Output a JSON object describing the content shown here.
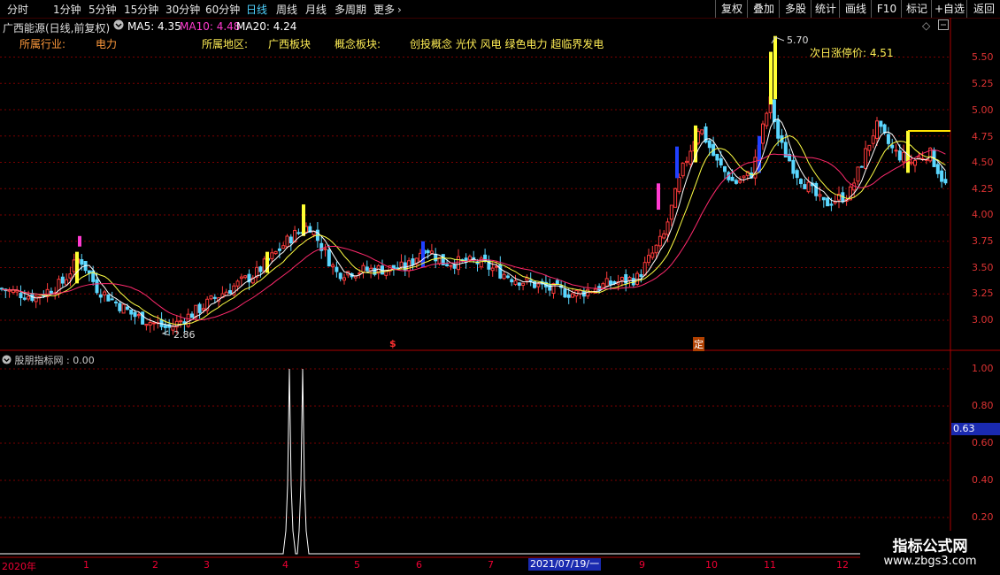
{
  "toolbar": {
    "timeframes": [
      "分时",
      "1分钟",
      "5分钟",
      "15分钟",
      "30分钟",
      "60分钟",
      "日线",
      "周线",
      "月线",
      "多周期",
      "更多"
    ],
    "buttons": [
      "复权",
      "叠加",
      "多股",
      "统计",
      "画线",
      "F10",
      "标记",
      "+自选",
      "返回"
    ]
  },
  "header": {
    "title": "广西能源(日线,前复权)",
    "ma5": "MA5: 4.35",
    "ma10": "MA10: 4.48",
    "ma20": "MA20: 4.24"
  },
  "categories": {
    "industry_label": "所属行业:",
    "industry_value": "电力",
    "region_label": "所属地区:",
    "region_value": "广西板块",
    "concept_label": "概念板块:",
    "concept_value": "创投概念 光伏 风电 绿色电力 超临界发电"
  },
  "annotations": {
    "high": "5.70",
    "low": "2.86",
    "limit_up": "次日涨停价: 4.51",
    "marker1": "$",
    "marker2": "定"
  },
  "price_axis": [
    "5.50",
    "5.25",
    "5.00",
    "4.75",
    "4.50",
    "4.25",
    "4.00",
    "3.75",
    "3.50",
    "3.25",
    "3.00"
  ],
  "indicator": {
    "title": "股朋指标网 : 0.00",
    "axis": [
      "1.00",
      "0.80",
      "0.60",
      "0.40",
      "0.20"
    ],
    "current": "0.63"
  },
  "x_axis": [
    "2020年",
    "1",
    "2",
    "3",
    "4",
    "5",
    "6",
    "7",
    "8",
    "9",
    "10",
    "11",
    "12"
  ],
  "cursor_date": "2021/07/19/一",
  "watermark": {
    "line1": "指标公式网",
    "line2": "www.zbgs3.com"
  },
  "colors": {
    "up": "#ff3b3b",
    "down": "#5bd7ff",
    "ma5": "#ffffff",
    "ma10": "#ffff44",
    "ma20": "#ff2a6d",
    "axis": "#d33"
  }
}
